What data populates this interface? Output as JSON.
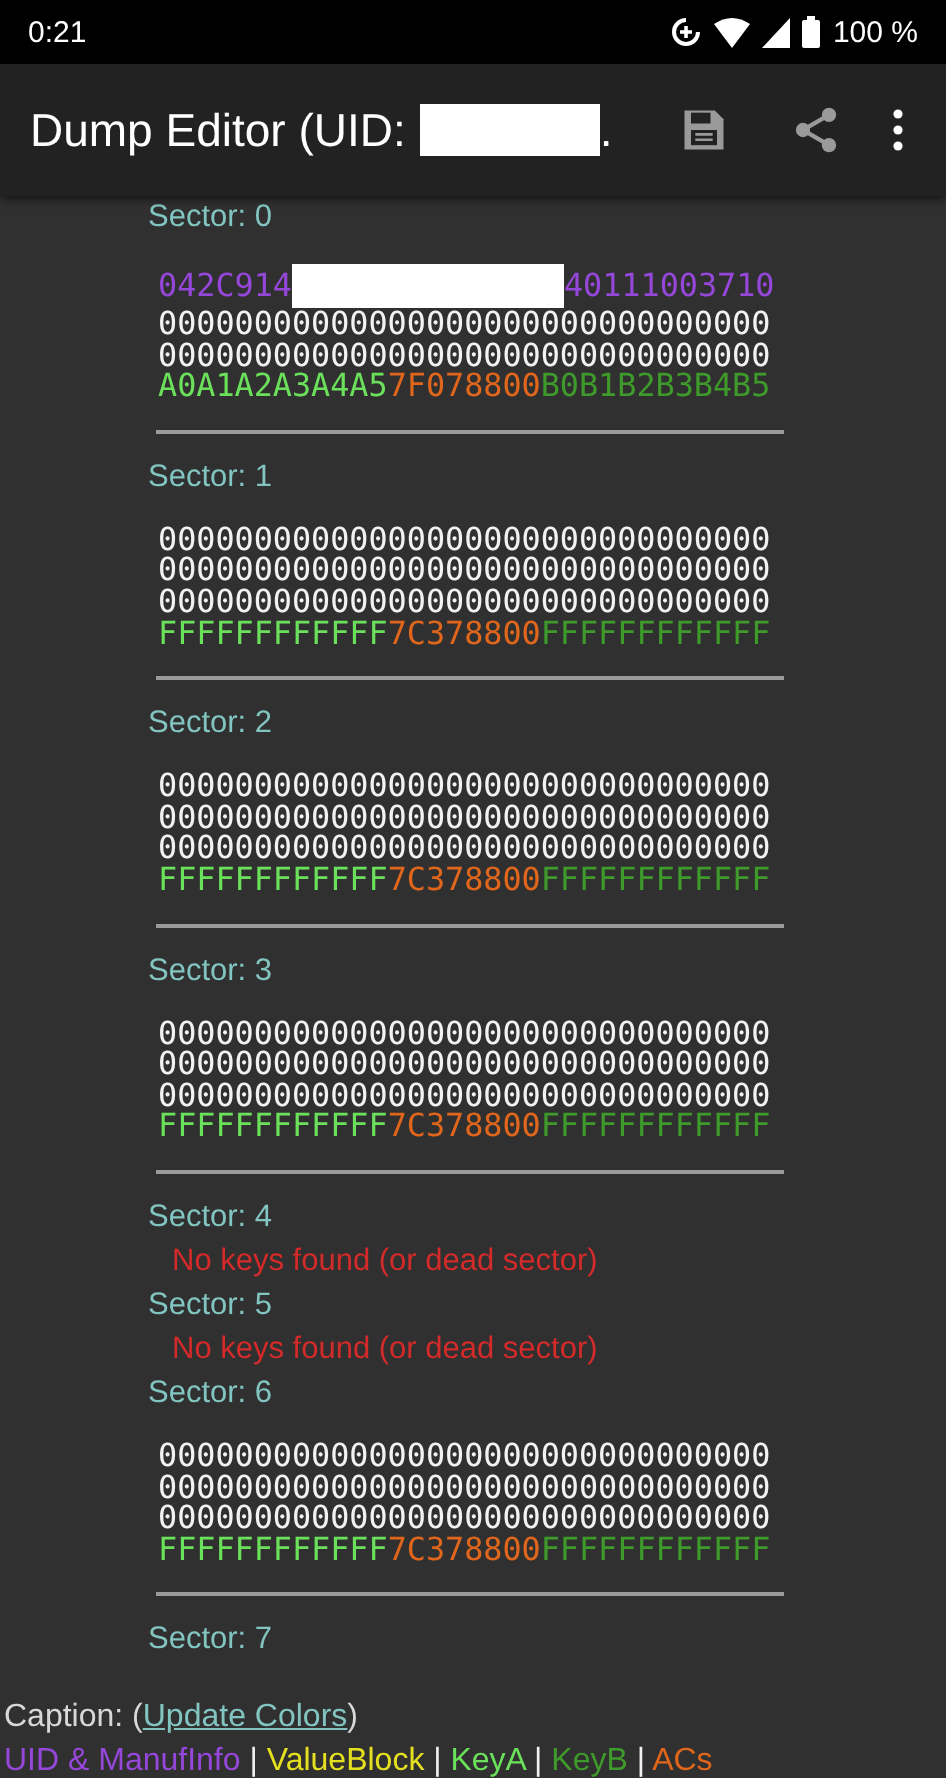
{
  "status_bar": {
    "time": "0:21",
    "battery": "100 %"
  },
  "app_bar": {
    "title_parts": [
      {
        "kind": "text",
        "text": "Dump Editor (UID:"
      },
      {
        "kind": "redacted"
      },
      {
        "kind": "text",
        "text": "."
      }
    ]
  },
  "sectors": [
    {
      "label": "Sector: 0",
      "kind": "blocks",
      "blocks": [
        {
          "segments": [
            {
              "kind": "uid",
              "text": "042C914"
            },
            {
              "kind": "redacted"
            },
            {
              "kind": "uid",
              "text": "40111003710"
            }
          ]
        },
        {
          "segments": [
            {
              "kind": "data",
              "text": "00000000000000000000000000000000"
            }
          ]
        },
        {
          "segments": [
            {
              "kind": "data",
              "text": "00000000000000000000000000000000"
            }
          ]
        },
        {
          "segments": [
            {
              "kind": "keya",
              "text": "A0A1A2A3A4A5"
            },
            {
              "kind": "acs",
              "text": "7F078800"
            },
            {
              "kind": "keyb",
              "text": "B0B1B2B3B4B5"
            }
          ]
        }
      ]
    },
    {
      "label": "Sector: 1",
      "kind": "blocks",
      "blocks": [
        {
          "segments": [
            {
              "kind": "data",
              "text": "00000000000000000000000000000000"
            }
          ]
        },
        {
          "segments": [
            {
              "kind": "data",
              "text": "00000000000000000000000000000000"
            }
          ]
        },
        {
          "segments": [
            {
              "kind": "data",
              "text": "00000000000000000000000000000000"
            }
          ]
        },
        {
          "segments": [
            {
              "kind": "keya",
              "text": "FFFFFFFFFFFF"
            },
            {
              "kind": "acs",
              "text": "7C378800"
            },
            {
              "kind": "keyb",
              "text": "FFFFFFFFFFFF"
            }
          ]
        }
      ]
    },
    {
      "label": "Sector: 2",
      "kind": "blocks",
      "blocks": [
        {
          "segments": [
            {
              "kind": "data",
              "text": "00000000000000000000000000000000"
            }
          ]
        },
        {
          "segments": [
            {
              "kind": "data",
              "text": "00000000000000000000000000000000"
            }
          ]
        },
        {
          "segments": [
            {
              "kind": "data",
              "text": "00000000000000000000000000000000"
            }
          ]
        },
        {
          "segments": [
            {
              "kind": "keya",
              "text": "FFFFFFFFFFFF"
            },
            {
              "kind": "acs",
              "text": "7C378800"
            },
            {
              "kind": "keyb",
              "text": "FFFFFFFFFFFF"
            }
          ]
        }
      ]
    },
    {
      "label": "Sector: 3",
      "kind": "blocks",
      "blocks": [
        {
          "segments": [
            {
              "kind": "data",
              "text": "00000000000000000000000000000000"
            }
          ]
        },
        {
          "segments": [
            {
              "kind": "data",
              "text": "00000000000000000000000000000000"
            }
          ]
        },
        {
          "segments": [
            {
              "kind": "data",
              "text": "00000000000000000000000000000000"
            }
          ]
        },
        {
          "segments": [
            {
              "kind": "keya",
              "text": "FFFFFFFFFFFF"
            },
            {
              "kind": "acs",
              "text": "7C378800"
            },
            {
              "kind": "keyb",
              "text": "FFFFFFFFFFFF"
            }
          ]
        }
      ]
    },
    {
      "label": "Sector: 4",
      "kind": "error",
      "message": "No keys found (or dead sector)"
    },
    {
      "label": "Sector: 5",
      "kind": "error",
      "message": "No keys found (or dead sector)"
    },
    {
      "label": "Sector: 6",
      "kind": "blocks",
      "blocks": [
        {
          "segments": [
            {
              "kind": "data",
              "text": "00000000000000000000000000000000"
            }
          ]
        },
        {
          "segments": [
            {
              "kind": "data",
              "text": "00000000000000000000000000000000"
            }
          ]
        },
        {
          "segments": [
            {
              "kind": "data",
              "text": "00000000000000000000000000000000"
            }
          ]
        },
        {
          "segments": [
            {
              "kind": "keya",
              "text": "FFFFFFFFFFFF"
            },
            {
              "kind": "acs",
              "text": "7C378800"
            },
            {
              "kind": "keyb",
              "text": "FFFFFFFFFFFF"
            }
          ]
        }
      ]
    },
    {
      "label": "Sector: 7",
      "kind": "header"
    }
  ],
  "caption": {
    "prefix": "Caption: (",
    "link": "Update Colors",
    "suffix": ")"
  },
  "legend": [
    {
      "kind": "uid",
      "text": "UID & ManufInfo"
    },
    {
      "kind": "sep",
      "text": " | "
    },
    {
      "kind": "value",
      "text": "ValueBlock"
    },
    {
      "kind": "sep",
      "text": " | "
    },
    {
      "kind": "keya",
      "text": "KeyA"
    },
    {
      "kind": "sep",
      "text": " | "
    },
    {
      "kind": "keyb",
      "text": "KeyB"
    },
    {
      "kind": "sep",
      "text": " | "
    },
    {
      "kind": "acs",
      "text": "ACs"
    }
  ]
}
